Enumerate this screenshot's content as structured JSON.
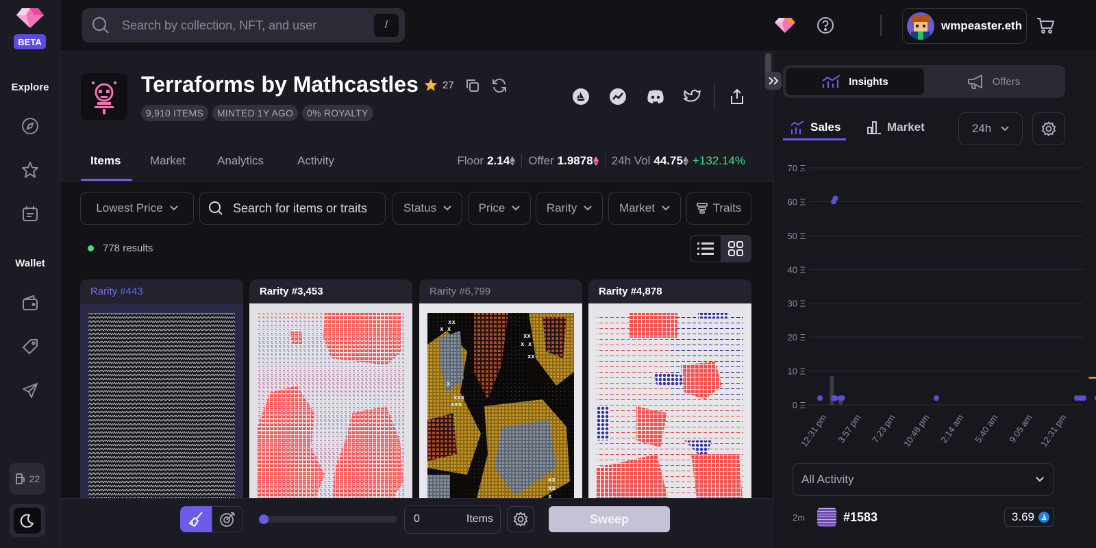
{
  "sidebar": {
    "beta_label": "BETA",
    "explore_label": "Explore",
    "wallet_label": "Wallet",
    "gas_value": "22"
  },
  "header": {
    "search_placeholder": "Search by collection, NFT, and user",
    "search_shortcut": "/",
    "username": "wmpeaster.eth"
  },
  "collection": {
    "title": "Terraforms by Mathcastles",
    "star_count": "27",
    "tags": [
      "9,910 ITEMS",
      "MINTED 1Y AGO",
      "0% ROYALTY"
    ],
    "tabs": [
      "Items",
      "Market",
      "Analytics",
      "Activity"
    ],
    "active_tab": "Items",
    "stats": {
      "floor_label": "Floor",
      "floor_value": "2.14",
      "offer_label": "Offer",
      "offer_value": "1.9878",
      "vol_label": "24h Vol",
      "vol_value": "44.75",
      "vol_change": "+132.14%"
    }
  },
  "filters": {
    "sort": "Lowest Price",
    "search_placeholder": "Search for items or traits",
    "status": "Status",
    "price": "Price",
    "rarity": "Rarity",
    "market": "Market",
    "traits": "Traits"
  },
  "results": {
    "count_text": "778 results"
  },
  "cards": [
    {
      "label": "Rarity",
      "rank": "#443"
    },
    {
      "label": "Rarity",
      "rank": "#3,453"
    },
    {
      "label": "Rarity",
      "rank": "#6,799"
    },
    {
      "label": "Rarity",
      "rank": "#4,878"
    }
  ],
  "sweep_bar": {
    "items_value": "0",
    "items_label": "Items",
    "sweep_label": "Sweep"
  },
  "panel": {
    "insights_label": "Insights",
    "offers_label": "Offers",
    "sales_tab": "Sales",
    "market_tab": "Market",
    "range": "24h",
    "activity_filter": "All Activity",
    "recent_sale": {
      "time": "2m",
      "name": "#1583",
      "price": "3.69"
    }
  },
  "colors": {
    "accent": "#6c5ce7",
    "positive": "#4ade80",
    "chart_points": "#5b4fd6",
    "floor_line": "#f0a04b"
  },
  "chart_data": {
    "type": "scatter",
    "y_ticks": [
      "70 Ξ",
      "60 Ξ",
      "50 Ξ",
      "40 Ξ",
      "30 Ξ",
      "20 Ξ",
      "10 Ξ",
      "0 Ξ"
    ],
    "x_ticks": [
      "12:31 pm",
      "3:57 pm",
      "7:23 pm",
      "10:48 pm",
      "2:14 am",
      "5:40 am",
      "9:05 am",
      "12:31 pm"
    ],
    "ylim": [
      0,
      70
    ],
    "grid": true,
    "points": [
      {
        "x": 1.0,
        "y": 2
      },
      {
        "x": 1.4,
        "y": 2
      },
      {
        "x": 1.45,
        "y": 2
      },
      {
        "x": 1.6,
        "y": 2
      },
      {
        "x": 1.65,
        "y": 2
      },
      {
        "x": 1.4,
        "y": 60
      },
      {
        "x": 1.45,
        "y": 61
      },
      {
        "x": 4.4,
        "y": 2
      },
      {
        "x": 8.5,
        "y": 2
      },
      {
        "x": 8.6,
        "y": 2
      },
      {
        "x": 8.7,
        "y": 2
      },
      {
        "x": 9.1,
        "y": 2
      },
      {
        "x": 9.6,
        "y": 2
      }
    ],
    "volume_bars": [
      {
        "x": 1.35,
        "y": 8.5
      },
      {
        "x": 1.6,
        "y": 2
      }
    ],
    "floor_segment": {
      "x0": 8.85,
      "x1": 9.65,
      "y": 8
    }
  }
}
